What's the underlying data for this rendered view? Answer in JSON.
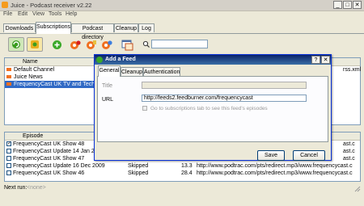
{
  "window": {
    "title": "Juice - Podcast receiver v2.22",
    "minimize": "_",
    "maximize": "□",
    "close": "✕"
  },
  "menu": [
    "File",
    "Edit",
    "View",
    "Tools",
    "Help"
  ],
  "tabs": [
    "Downloads",
    "Subscriptions",
    "Podcast directory",
    "Cleanup",
    "Log"
  ],
  "active_tab": "Subscriptions",
  "subscriptions": {
    "header_name": "Name",
    "rows": [
      "Default Channel",
      "Juice News",
      "FrequencyCast UK TV and Tech"
    ],
    "right_fragment": "rss.xml"
  },
  "episodes": {
    "header": "Episode",
    "rows": [
      {
        "checked": true,
        "name": "FrequencyCast UK Show 48",
        "status": "",
        "size": "",
        "url": "ast.c"
      },
      {
        "checked": false,
        "name": "FrequencyCast Update 14 Jan 20",
        "status": "",
        "size": "",
        "url": "ast.c"
      },
      {
        "checked": false,
        "name": "FrequencyCast UK Show 47",
        "status": "",
        "size": "",
        "url": "ast.c"
      },
      {
        "checked": false,
        "name": "FrequencyCast Update 16 Dec 2009",
        "status": "Skipped",
        "size": "13.3",
        "url": "http://www.podtrac.com/pts/redirect.mp3/www.frequencycast.c"
      },
      {
        "checked": false,
        "name": "FrequencyCast UK Show 46",
        "status": "Skipped",
        "size": "28.4",
        "url": "http://www.podtrac.com/pts/redirect.mp3/www.frequencycast.c"
      }
    ]
  },
  "status_bar": {
    "label": "Next run:",
    "value": "<none>"
  },
  "dialog": {
    "title": "Add a Feed",
    "tabs": [
      "General",
      "Cleanup",
      "Authentication"
    ],
    "title_label": "Title",
    "title_value": "",
    "url_label": "URL",
    "url_value": "http://feeds2.feedburner.com/frequencycast",
    "goto_label": "Go to subscriptions tab to see this feed's episodes",
    "save": "Save",
    "cancel": "Cancel",
    "help_btn": "?",
    "close_btn": "✕"
  }
}
